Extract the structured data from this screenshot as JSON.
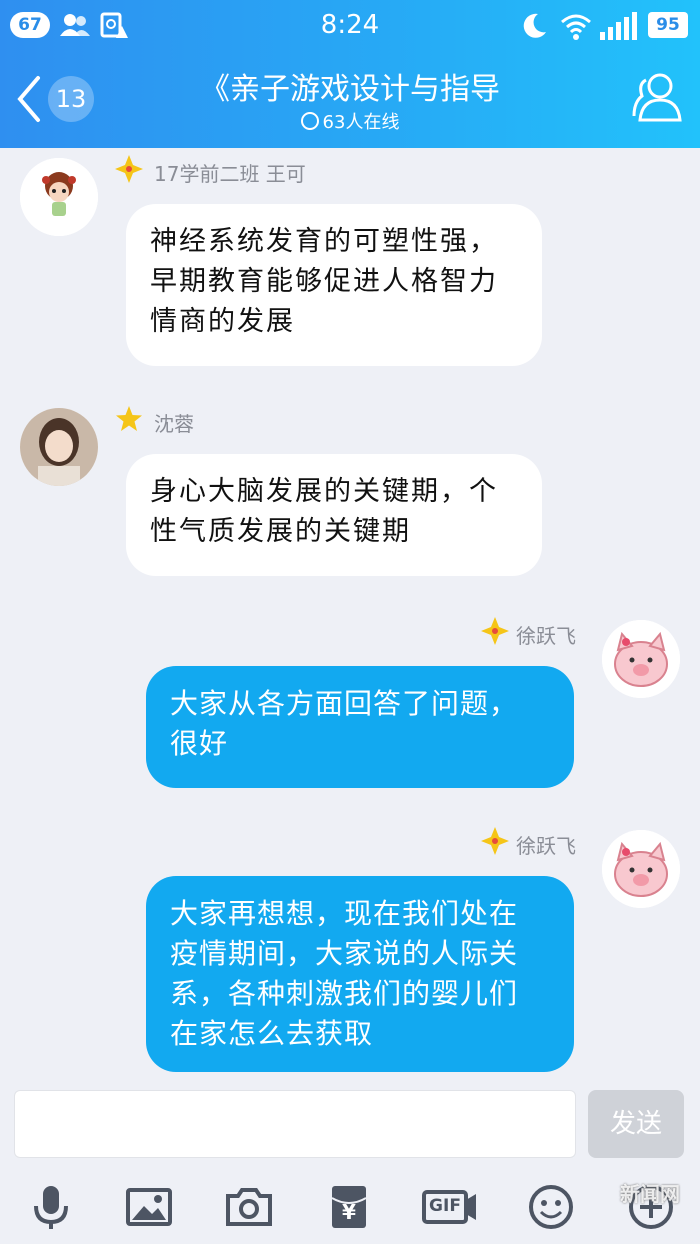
{
  "status_bar": {
    "notification_count": "67",
    "time": "8:24",
    "battery": "95"
  },
  "header": {
    "back_count": "13",
    "title": "《亲子游戏设计与指导",
    "online": "63人在线"
  },
  "messages": [
    {
      "side": "left",
      "sender": "17学前二班 王可",
      "text_lines": [
        "神经系统发育的可塑性强，",
        "早期教育能够促进人格智力",
        "情商的发展"
      ]
    },
    {
      "side": "left",
      "sender": "沈蓉",
      "text_lines": [
        "身心大脑发展的关键期，个",
        "性气质发展的关键期"
      ]
    },
    {
      "side": "right",
      "sender": "徐跃飞",
      "text_lines": [
        "大家从各方面回答了问题，",
        "很好"
      ]
    },
    {
      "side": "right",
      "sender": "徐跃飞",
      "text_lines": [
        "大家再想想，现在我们处在",
        "疫情期间，大家说的人际关",
        "系，各种刺激我们的婴儿们",
        "在家怎么去获取"
      ]
    }
  ],
  "input": {
    "value": "",
    "placeholder": "",
    "send_label": "发送"
  },
  "toolbar": {
    "icons": [
      "microphone-icon",
      "image-icon",
      "camera-icon",
      "red-packet-icon",
      "gif-icon",
      "emoji-icon",
      "more-icon"
    ],
    "gif_label": "GIF",
    "yen_label": "¥"
  },
  "watermark": "新闻网",
  "colors": {
    "header_start": "#2f8ff0",
    "header_end": "#22c2fb",
    "bubble_right": "#12a9f0",
    "bubble_left": "#ffffff",
    "background": "#eef0f6"
  }
}
